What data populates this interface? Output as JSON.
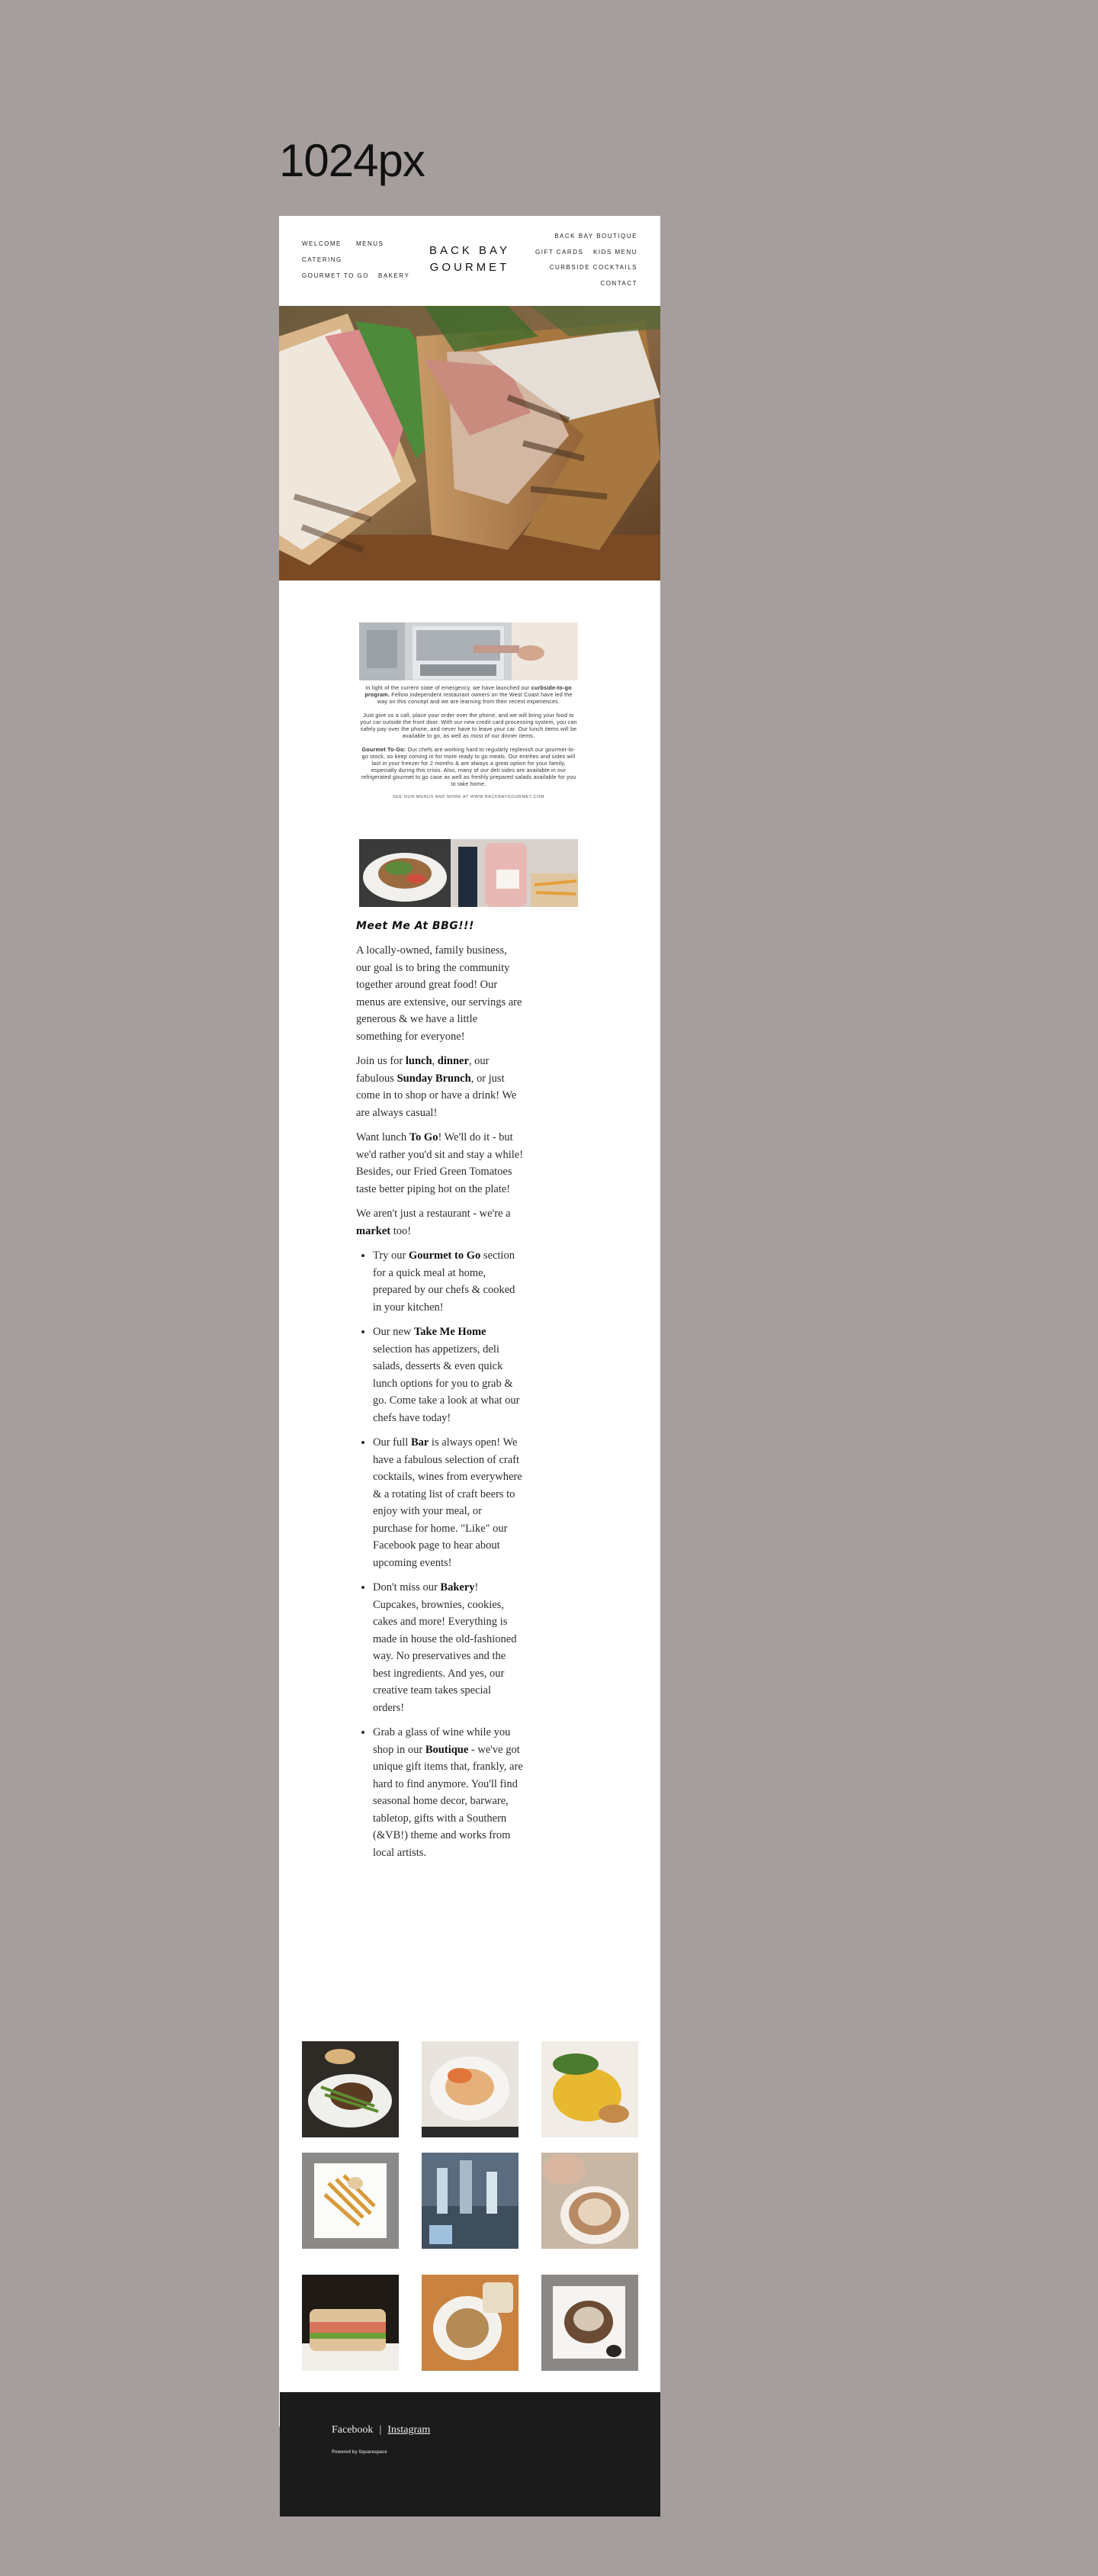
{
  "viewport_label": "1024px",
  "header": {
    "logo_line1": "BACK BAY",
    "logo_line2": "GOURMET",
    "nav_left": [
      "WELCOME",
      "MENUS",
      "CATERING",
      "GOURMET TO GO",
      "BAKERY"
    ],
    "nav_right": [
      "BACK BAY BOUTIQUE",
      "GIFT CARDS",
      "KIDS MENU",
      "CURBSIDE COCKTAILS",
      "CONTACT"
    ]
  },
  "notice": {
    "p1_a": "In light of the current state of emergency, we have launched our ",
    "p1_bold": "curbside-to-go program.",
    "p1_b": " Fellow independent restaurant owners on the West Coast have led the way on this concept and we are learning from their recent experiences.",
    "p2": "Just give us a call, place your order over the phone, and we will bring your food to your car outside the front door. With our new credit card processing system, you can safely pay over the phone, and never have to leave your car. Our lunch items will be available to go, as well as most of our dinner items.",
    "p3_bold": "Gourmet To-Go:",
    "p3": " Our chefs are working hard to regularly replenish our gourmet-to-go stock, so keep coming in for more ready to go meals. Our entrées and sides will last in your freezer for 2 months & are always a great option for your family, especially during this crisis. Also, many of our deli sides are available in our refrigerated gourmet to go case as well as freshly prepared salads available for you to take home.",
    "fine": "SEE OUR MENUS AND MORE AT WWW.BACKBAYGOURMET.COM"
  },
  "content": {
    "heading": "Meet Me At BBG!!!",
    "p1": "A locally-owned, family business, our goal is to bring the community together around great food! Our menus are extensive, our servings are generous & we have a little something for everyone!",
    "p2_a": "Join us for ",
    "p2_b1": "lunch",
    "p2_c": ", ",
    "p2_b2": "dinner",
    "p2_d": ", our fabulous ",
    "p2_b3": "Sunday Brunch",
    "p2_e": ", or just come in to shop or have a drink! We are always casual!",
    "p3_a": "Want lunch ",
    "p3_b": "To Go",
    "p3_c": "!  We'll do it - but we'd rather you'd sit and stay a while!  Besides, our Fried Green Tomatoes taste better piping hot on the plate!",
    "p4_a": "We aren't just a restaurant - we're a ",
    "p4_b": "market",
    "p4_c": " too!",
    "li1_a": "Try our ",
    "li1_b": "Gourmet to Go",
    "li1_c": " section for a quick meal at home, prepared by our chefs & cooked in your kitchen!",
    "li2_a": "Our new ",
    "li2_b": "Take Me Home",
    "li2_c": " selection has appetizers, deli salads, desserts & even quick lunch options for you to grab & go.  Come take a look at what our chefs have today!",
    "li3_a": "Our full ",
    "li3_b": "Bar",
    "li3_c": " is always open!  We have a fabulous selection of craft cocktails, wines from everywhere & a rotating list of craft beers to enjoy with your meal, or purchase for home.  \"Like\" our Facebook page to hear about upcoming events!",
    "li4_a": "Don't miss our ",
    "li4_b": "Bakery",
    "li4_c": "!  Cupcakes, brownies, cookies, cakes and more!  Everything is made in house the old-fashioned way.  No preservatives and the best ingredients.  And yes, our creative team takes special orders!",
    "li5_a": "Grab a glass of wine while you shop in our ",
    "li5_b": "Boutique",
    "li5_c": " - we've got  unique gift items that, frankly, are hard to find anymore.  You'll find seasonal home decor, barware, tabletop, gifts with a Southern (&VB!) theme and works from local artists."
  },
  "footer": {
    "facebook": "Facebook",
    "separator": "|",
    "instagram": "Instagram",
    "powered": "Powered by Squarespace"
  },
  "colors": {
    "page_bg": "#a69d9d",
    "footer_bg": "#1b1b1b",
    "text": "#2c2c2c"
  }
}
